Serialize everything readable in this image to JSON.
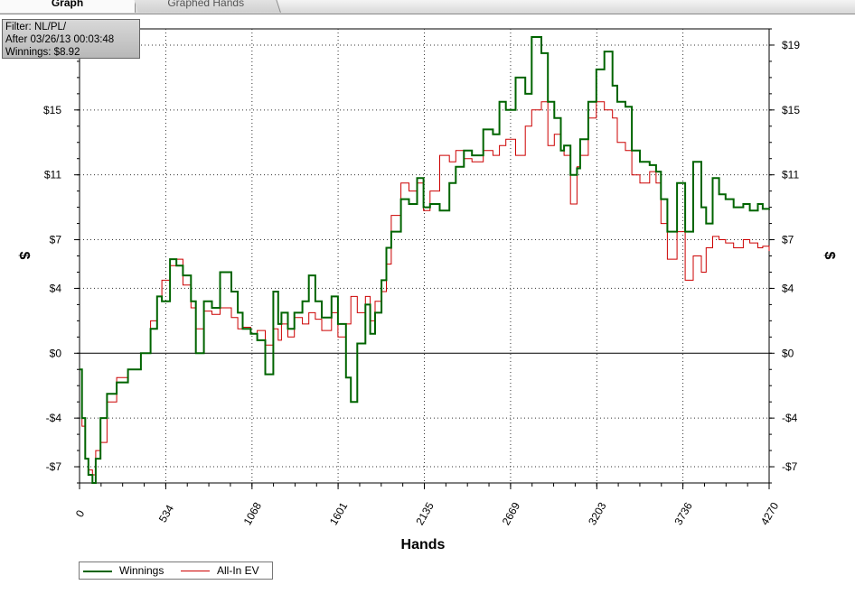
{
  "tabs": [
    {
      "label": "Graph",
      "active": true
    },
    {
      "label": "Graphed Hands",
      "active": false
    }
  ],
  "info": {
    "filter": "Filter: NL/PL/",
    "after": "After 03/26/13 00:03:48",
    "winnings": "Winnings: $8.92"
  },
  "chart_data": {
    "type": "line",
    "title": "",
    "xlabel": "Hands",
    "ylabel": "$",
    "xlim": [
      0,
      4270
    ],
    "ylim": [
      -8,
      20
    ],
    "x_ticks": [
      0,
      534,
      1068,
      1601,
      2135,
      2669,
      3203,
      3736,
      4270
    ],
    "y_ticks": [
      -7,
      -4,
      0,
      4,
      7,
      11,
      15,
      19
    ],
    "y_tick_labels": [
      "-$7",
      "-$4",
      "$0",
      "$4",
      "$7",
      "$11",
      "$15",
      "$19"
    ],
    "grid": true,
    "legend": "bottom-left",
    "colors": {
      "winnings": "#006400",
      "allin_ev": "#cc0000"
    },
    "series": [
      {
        "name": "Winnings",
        "x": [
          0,
          15,
          35,
          55,
          80,
          100,
          130,
          170,
          230,
          300,
          380,
          440,
          480,
          510,
          560,
          600,
          640,
          690,
          720,
          770,
          820,
          870,
          940,
          980,
          1010,
          1060,
          1100,
          1150,
          1200,
          1230,
          1250,
          1290,
          1330,
          1380,
          1420,
          1460,
          1500,
          1560,
          1600,
          1650,
          1680,
          1720,
          1770,
          1800,
          1830,
          1870,
          1900,
          1930,
          1990,
          2040,
          2090,
          2130,
          2170,
          2230,
          2290,
          2330,
          2380,
          2430,
          2500,
          2560,
          2600,
          2640,
          2700,
          2760,
          2800,
          2860,
          2900,
          2940,
          2980,
          3000,
          3040,
          3080,
          3100,
          3150,
          3200,
          3250,
          3300,
          3330,
          3380,
          3420,
          3470,
          3530,
          3570,
          3600,
          3640,
          3700,
          3750,
          3800,
          3850,
          3880,
          3920,
          3960,
          4000,
          4050,
          4110,
          4150,
          4200,
          4230,
          4270
        ],
        "y": [
          -1,
          -4,
          -6.5,
          -7.5,
          -8,
          -6.5,
          -4,
          -2.5,
          -1.8,
          -1,
          0,
          1.5,
          3.5,
          3.2,
          5.8,
          5.4,
          4.8,
          3.2,
          0,
          3.2,
          2.8,
          5,
          3.8,
          2.5,
          1.5,
          1.2,
          0.8,
          -1.3,
          3.8,
          1.8,
          2.5,
          1.5,
          2.5,
          3.2,
          4.8,
          3.2,
          2.2,
          3.5,
          1.8,
          -1.5,
          -3,
          0.6,
          3,
          1.2,
          2.5,
          4.5,
          6.5,
          7.5,
          9.5,
          9.2,
          10.8,
          9,
          9.2,
          8.8,
          10.5,
          11.5,
          12.5,
          12.2,
          13.8,
          13.5,
          15.5,
          15,
          17,
          16,
          19.5,
          18.5,
          15.5,
          14.5,
          12.5,
          12.8,
          11,
          11.4,
          13.2,
          15.5,
          17.5,
          18.6,
          16.5,
          15.5,
          15.2,
          12.5,
          11.8,
          11.6,
          11.2,
          9.5,
          7.5,
          10.5,
          7.5,
          11.8,
          9,
          8,
          10.8,
          9.8,
          9.5,
          9,
          9.2,
          8.8,
          9.2,
          8.9,
          8.92
        ]
      },
      {
        "name": "All-In EV",
        "x": [
          0,
          15,
          35,
          55,
          80,
          100,
          130,
          170,
          230,
          300,
          380,
          440,
          480,
          510,
          560,
          600,
          640,
          690,
          720,
          770,
          820,
          870,
          940,
          980,
          1010,
          1060,
          1100,
          1150,
          1200,
          1230,
          1250,
          1290,
          1330,
          1380,
          1420,
          1460,
          1500,
          1560,
          1600,
          1650,
          1680,
          1720,
          1770,
          1800,
          1830,
          1870,
          1900,
          1930,
          1990,
          2040,
          2090,
          2130,
          2170,
          2230,
          2290,
          2330,
          2380,
          2430,
          2500,
          2560,
          2600,
          2640,
          2700,
          2760,
          2800,
          2860,
          2900,
          2940,
          2980,
          3000,
          3040,
          3080,
          3100,
          3150,
          3200,
          3250,
          3300,
          3330,
          3380,
          3420,
          3470,
          3530,
          3570,
          3600,
          3640,
          3700,
          3750,
          3800,
          3850,
          3880,
          3920,
          3960,
          4000,
          4050,
          4110,
          4150,
          4200,
          4230,
          4270
        ],
        "y": [
          -1,
          -4.5,
          -6.5,
          -7.2,
          -7.5,
          -6,
          -5.5,
          -3,
          -1.5,
          -1,
          0,
          2,
          3.5,
          4.5,
          5.4,
          5.8,
          4.2,
          2.8,
          1.5,
          2.6,
          2.4,
          2.8,
          2.2,
          1.5,
          1.6,
          1.2,
          1.4,
          0.5,
          1.5,
          0.8,
          1.8,
          1,
          2.2,
          1.8,
          2.5,
          2.1,
          1.4,
          2.5,
          1,
          1.8,
          3.5,
          2.5,
          3.5,
          2,
          3.2,
          3.8,
          5.5,
          8.5,
          10.5,
          10,
          10.5,
          8.8,
          10,
          12.2,
          11.8,
          12.5,
          12,
          11.8,
          12.5,
          12.2,
          12.8,
          13.2,
          12.2,
          14,
          15,
          15.5,
          12.8,
          13.5,
          12.5,
          12.2,
          9.2,
          11.5,
          12.2,
          14.5,
          15.5,
          15,
          14.5,
          13,
          12.5,
          11,
          10.5,
          11.2,
          10.5,
          8,
          5.8,
          7.5,
          4.5,
          6,
          5,
          6.5,
          7.2,
          7,
          6.8,
          6.5,
          7,
          6.8,
          6.5,
          6.6,
          6.3
        ]
      }
    ]
  }
}
